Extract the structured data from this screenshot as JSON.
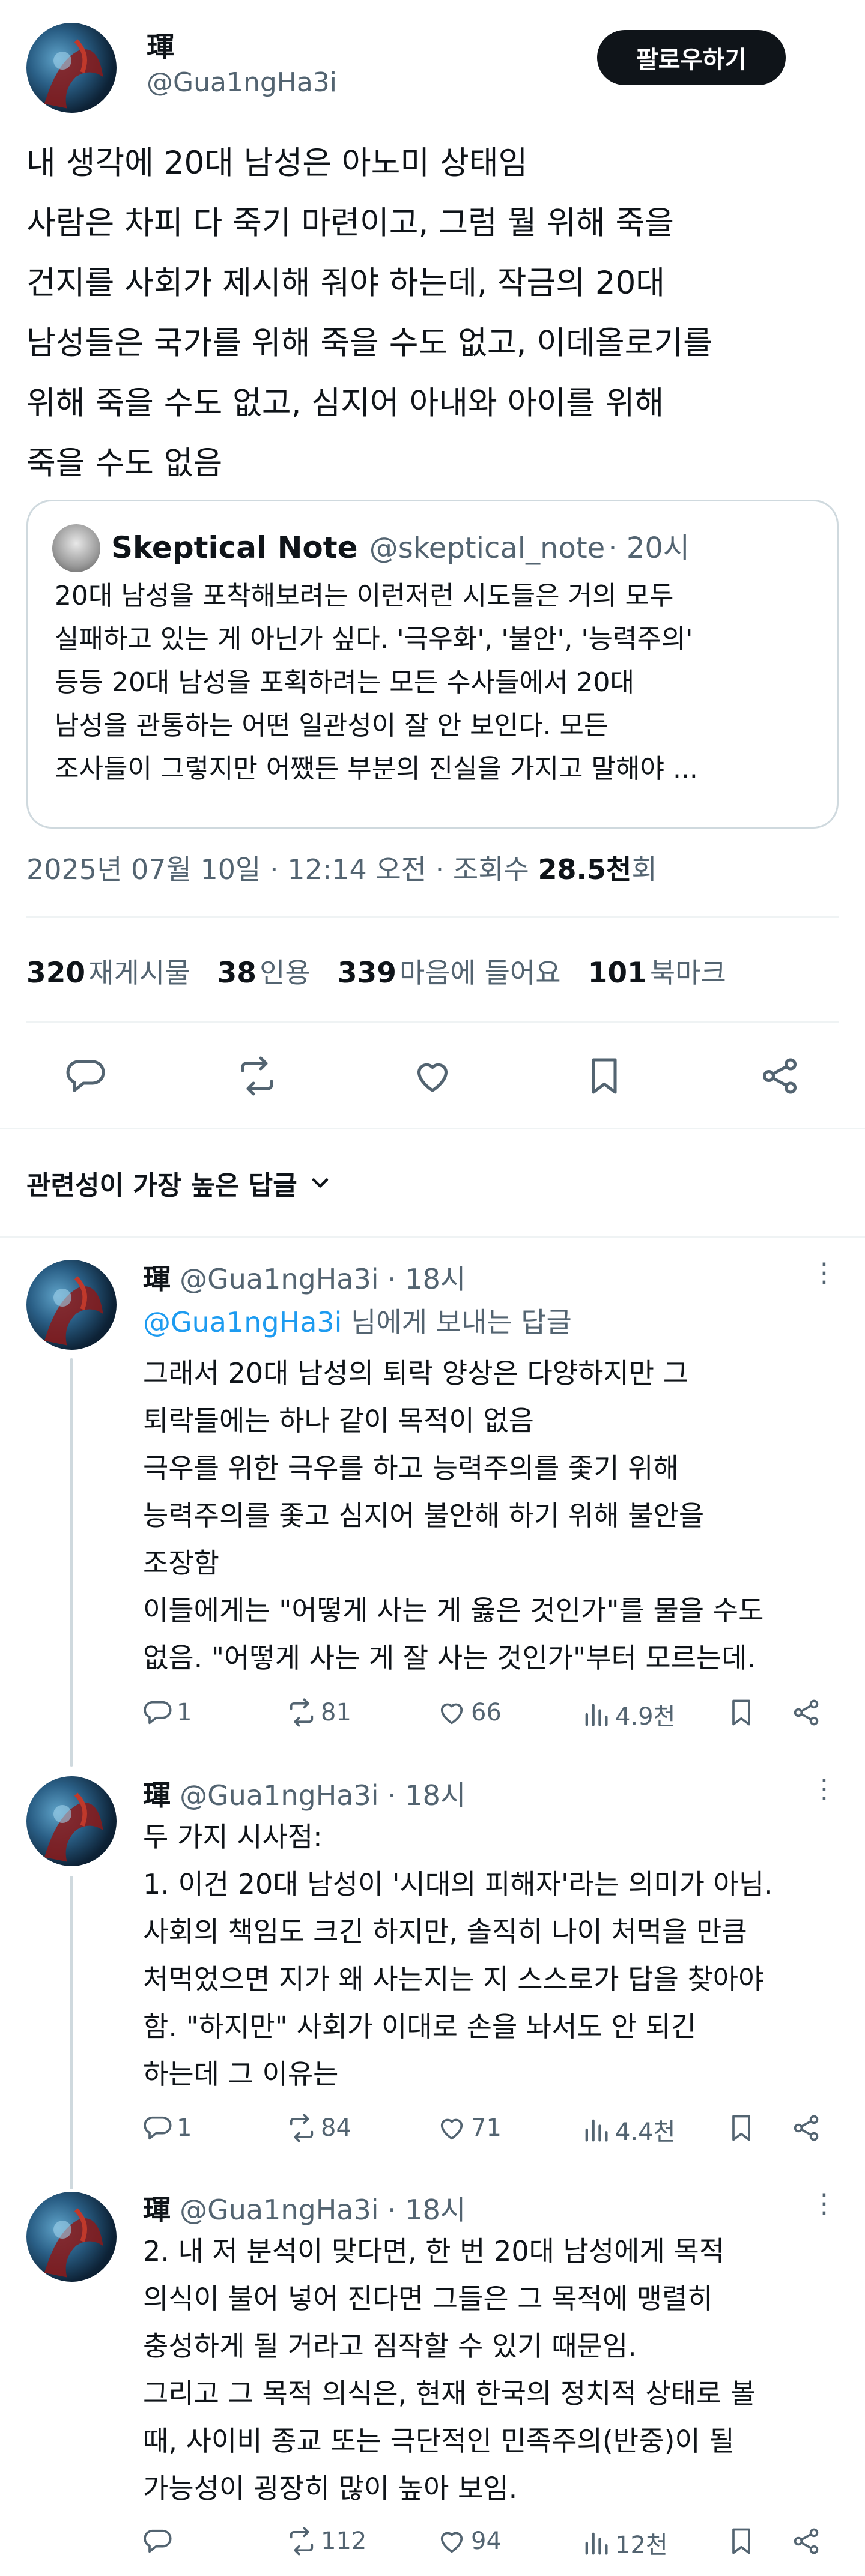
{
  "post": {
    "display_name": "琿",
    "handle": "@Gua1ngHa3i",
    "follow_label": "팔로우하기",
    "text_lines": [
      "내 생각에 20대 남성은 아노미 상태임",
      "사람은 차피 다 죽기 마련이고, 그럼 뭘 위해 죽을",
      "건지를 사회가 제시해 줘야 하는데, 작금의 20대",
      "남성들은 국가를 위해 죽을 수도 없고, 이데올로기를",
      "위해 죽을 수도 없고, 심지어 아내와 아이를 위해",
      "죽을 수도 없음"
    ],
    "quote": {
      "name": "Skeptical Note",
      "handle": "@skeptical_note",
      "time": "20시",
      "text_lines": [
        "20대 남성을 포착해보려는 이런저런 시도들은 거의 모두",
        "실패하고 있는 게 아닌가 싶다. '극우화', '불안', '능력주의'",
        "등등 20대 남성을 포획하려는 모든 수사들에서 20대",
        "남성을 관통하는 어떤 일관성이 잘 안 보인다. 모든",
        "조사들이 그렇지만 어쨌든 부분의 진실을 가지고 말해야 ..."
      ]
    },
    "timestamp": "2025년 07월 10일 · 12:14 오전 · 조회수 ",
    "views": "28.5천",
    "views_suffix": "회",
    "stats": {
      "reposts_num": "320",
      "reposts_label": "재게시물",
      "quotes_num": "38",
      "quotes_label": "인용",
      "likes_num": "339",
      "likes_label": "마음에 들어요",
      "bookmarks_num": "101",
      "bookmarks_label": "북마크"
    }
  },
  "sort": {
    "label": "관련성이 가장 높은 답글"
  },
  "replies": [
    {
      "name": "琿",
      "handle_time": "@Gua1ngHa3i · 18시",
      "reply_to_link": "@Gua1ngHa3i",
      "reply_to_suffix": " 님에게 보내는 답글",
      "text_lines": [
        "그래서 20대 남성의 퇴락 양상은 다양하지만 그",
        "퇴락들에는 하나 같이 목적이 없음",
        "극우를 위한 극우를 하고 능력주의를 좇기 위해",
        "능력주의를 좇고 심지어 불안해 하기 위해 불안을",
        "조장함",
        "이들에게는 \"어떻게 사는 게 옳은 것인가\"를 물을 수도",
        "없음. \"어떻게 사는 게 잘 사는 것인가\"부터 모르는데."
      ],
      "replies": "1",
      "reposts": "81",
      "likes": "66",
      "views": "4.9천"
    },
    {
      "name": "琿",
      "handle_time": "@Gua1ngHa3i · 18시",
      "text_lines": [
        "두 가지 시사점:",
        "1. 이건 20대 남성이 '시대의 피해자'라는 의미가 아님.",
        "사회의 책임도 크긴 하지만, 솔직히 나이 처먹을 만큼",
        "처먹었으면 지가 왜 사는지는 지 스스로가 답을 찾아야",
        "함. \"하지만\" 사회가 이대로 손을 놔서도 안 되긴",
        "하는데 그 이유는"
      ],
      "replies": "1",
      "reposts": "84",
      "likes": "71",
      "views": "4.4천"
    },
    {
      "name": "琿",
      "handle_time": "@Gua1ngHa3i · 18시",
      "text_lines": [
        "2. 내 저 분석이 맞다면, 한 번 20대 남성에게 목적",
        "의식이 불어 넣어 진다면 그들은 그 목적에 맹렬히",
        "충성하게 될 거라고 짐작할 수 있기 때문임.",
        "그리고 그 목적 의식은, 현재 한국의 정치적 상태로 볼",
        "때, 사이비 종교 또는 극단적인 민족주의(반중)이 될",
        "가능성이 굉장히 많이 높아 보임."
      ],
      "replies": "",
      "reposts": "112",
      "likes": "94",
      "views": "12천"
    }
  ],
  "icons": {
    "reply": "reply-icon",
    "repost": "repost-icon",
    "like": "heart-icon",
    "bookmark": "bookmark-icon",
    "share": "share-icon",
    "views": "views-icon",
    "chevron": "chevron-down-icon",
    "more": "more-icon"
  },
  "colors": {
    "link": "#1d9bf0",
    "secondary": "#536471",
    "primary": "#0f1419",
    "border": "#cfd9de"
  }
}
